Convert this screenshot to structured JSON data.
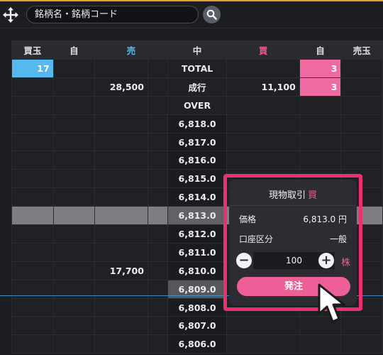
{
  "search": {
    "placeholder": "銘柄名・銘柄コード"
  },
  "columns": [
    "買玉",
    "自",
    "売",
    "中",
    "買",
    "自",
    "売玉"
  ],
  "rows": [
    {
      "buy_pos": "17",
      "self_l": "",
      "sell": "",
      "price": "TOTAL",
      "buy": "",
      "self_r": "3",
      "sell_pos": ""
    },
    {
      "buy_pos": "",
      "self_l": "",
      "sell": "28,500",
      "price": "成行",
      "buy": "11,100",
      "self_r": "3",
      "sell_pos": ""
    },
    {
      "buy_pos": "",
      "self_l": "",
      "sell": "",
      "price": "OVER",
      "buy": "",
      "self_r": "",
      "sell_pos": ""
    },
    {
      "buy_pos": "",
      "self_l": "",
      "sell": "",
      "price": "6,818.0",
      "buy": "",
      "self_r": "",
      "sell_pos": ""
    },
    {
      "buy_pos": "",
      "self_l": "",
      "sell": "",
      "price": "6,817.0",
      "buy": "",
      "self_r": "",
      "sell_pos": ""
    },
    {
      "buy_pos": "",
      "self_l": "",
      "sell": "",
      "price": "6,816.0",
      "buy": "",
      "self_r": "",
      "sell_pos": ""
    },
    {
      "buy_pos": "",
      "self_l": "",
      "sell": "",
      "price": "6,815.0",
      "buy": "",
      "self_r": "",
      "sell_pos": ""
    },
    {
      "buy_pos": "",
      "self_l": "",
      "sell": "",
      "price": "6,814.0",
      "buy": "",
      "self_r": "",
      "sell_pos": ""
    },
    {
      "buy_pos": "",
      "self_l": "",
      "sell": "",
      "price": "6,813.0",
      "buy": "",
      "self_r": "",
      "sell_pos": ""
    },
    {
      "buy_pos": "",
      "self_l": "",
      "sell": "",
      "price": "6,812.0",
      "buy": "",
      "self_r": "",
      "sell_pos": ""
    },
    {
      "buy_pos": "",
      "self_l": "",
      "sell": "",
      "price": "6,811.0",
      "buy": "",
      "self_r": "",
      "sell_pos": ""
    },
    {
      "buy_pos": "",
      "self_l": "",
      "sell": "17,700",
      "price": "6,810.0",
      "buy": "",
      "self_r": "",
      "sell_pos": ""
    },
    {
      "buy_pos": "",
      "self_l": "",
      "sell": "",
      "price": "6,809.0",
      "buy": "",
      "self_r": "",
      "sell_pos": ""
    },
    {
      "buy_pos": "",
      "self_l": "",
      "sell": "",
      "price": "6,808.0",
      "buy": "",
      "self_r": "",
      "sell_pos": ""
    },
    {
      "buy_pos": "",
      "self_l": "",
      "sell": "",
      "price": "6,807.0",
      "buy": "",
      "self_r": "",
      "sell_pos": ""
    },
    {
      "buy_pos": "",
      "self_l": "",
      "sell": "",
      "price": "6,806.0",
      "buy": "",
      "self_r": "",
      "sell_pos": ""
    }
  ],
  "order_panel": {
    "title": "現物取引",
    "side": "買",
    "price_label": "価格",
    "price_value": "6,813.0 円",
    "account_label": "口座区分",
    "account_value": "一般",
    "minus": "−",
    "plus": "+",
    "quantity": "100",
    "unit": "株",
    "submit_label": "発注"
  },
  "colors": {
    "accent_pink": "#ee5f97",
    "sell_blue": "#55b8ee",
    "highlight_frame": "#ec2f6f",
    "top_accent": "#e89a2c"
  },
  "icons": [
    "move-icon",
    "search-icon",
    "pointer-cursor-icon"
  ]
}
